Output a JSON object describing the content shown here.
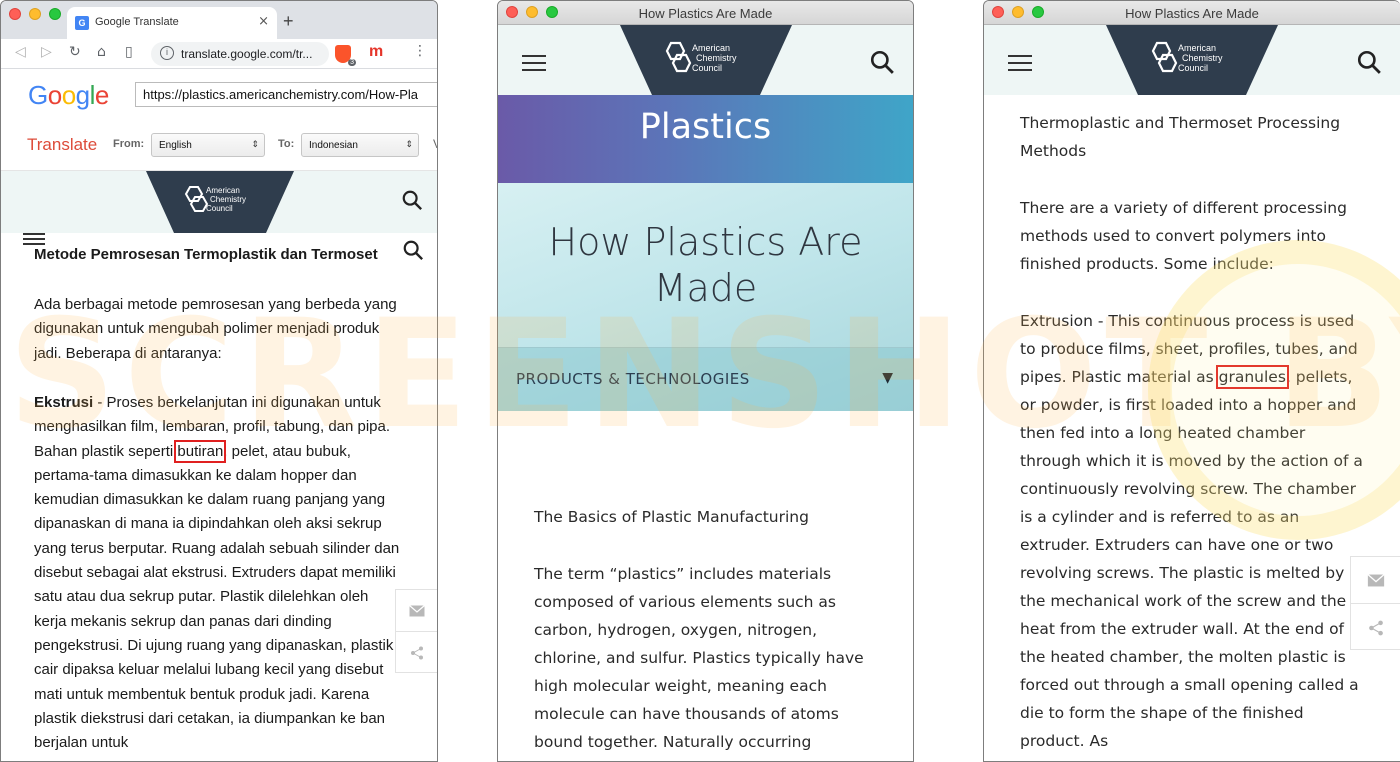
{
  "chrome": {
    "tab_title": "Google Translate",
    "tab_close": "×",
    "new_tab": "+",
    "url": "translate.google.com/tr...",
    "brave_badge": "3",
    "ext_label": "m",
    "menu": "⋮",
    "favicon_text": "G"
  },
  "translate": {
    "logo_letters": [
      {
        "ch": "G",
        "color": "#4285f4"
      },
      {
        "ch": "o",
        "color": "#ea4335"
      },
      {
        "ch": "o",
        "color": "#fbbc05"
      },
      {
        "ch": "g",
        "color": "#4285f4"
      },
      {
        "ch": "l",
        "color": "#34a853"
      },
      {
        "ch": "e",
        "color": "#ea4335"
      }
    ],
    "source_url": "https://plastics.americanchemistry.com/How-Pla",
    "title": "Translate",
    "from_label": "From:",
    "from_value": "English",
    "to_label": "To:",
    "to_value": "Indonesian",
    "more": "V"
  },
  "acc": {
    "logo_line1": "American",
    "logo_line2": "Chemistry",
    "logo_line3": "Council",
    "header_bg": "#eef6f5",
    "trap_color": "#2f3d4d"
  },
  "window1": {
    "heading": "Metode Pemrosesan Termoplastik dan Termoset",
    "para1": "Ada berbagai metode pemrosesan yang berbeda yang digunakan untuk mengubah polimer menjadi produk jadi. Beberapa di antaranya:",
    "bold_term": "Ekstrusi",
    "para2_a": " - Proses berkelanjutan ini digunakan untuk menghasilkan film, lembaran, profil, tabung, dan pipa. Bahan plastik seperti ",
    "highlight": "butiran",
    "para2_b": ", pelet, atau bubuk, pertama-tama dimasukkan ke dalam hopper dan kemudian dimasukkan ke dalam ruang panjang yang dipanaskan di mana ia dipindahkan oleh aksi sekrup yang terus berputar. Ruang adalah sebuah silinder dan disebut sebagai alat ekstrusi. Extruders dapat memiliki satu atau dua sekrup putar. Plastik dilelehkan oleh kerja mekanis sekrup dan panas dari dinding pengekstrusi. Di ujung ruang yang dipanaskan, plastik cair dipaksa keluar melalui lubang kecil yang disebut mati untuk membentuk bentuk produk jadi. Karena plastik diekstrusi dari cetakan, ia diumpankan ke ban berjalan untuk"
  },
  "window2": {
    "title": "How Plastics Are Made",
    "banner": "Plastics",
    "hero_title": "How Plastics Are Made",
    "products_label": "PRODUCTS & TECHNOLOGIES",
    "products_arrow": "▼",
    "subheading": "The Basics of Plastic Manufacturing",
    "para": "The term “plastics” includes materials composed of various elements such as carbon, hydrogen, oxygen, nitrogen, chlorine, and sulfur. Plastics typically have high molecular weight, meaning each molecule can have thousands of atoms bound together. Naturally occurring"
  },
  "window3": {
    "title": "How Plastics Are Made",
    "heading": "Thermoplastic and Thermoset Processing Methods",
    "para1": "There are a variety of different processing methods used to convert polymers into finished products. Some include:",
    "para2_a": "Extrusion - This continuous process is used to produce films, sheet, profiles, tubes, and pipes. Plastic material as ",
    "highlight": "granules",
    "para2_b": ", pellets, or powder, is first loaded into a hopper and then fed into a long heated chamber through which it is moved by the action of a continuously revolving screw. The chamber is a cylinder and is referred to as an extruder. Extruders can have one or two revolving screws. The plastic is melted by the mechanical work of the screw and the heat from the extruder wall. At the end of the heated chamber, the molten plastic is forced out through a small opening called a die to form the shape of the finished product. As"
  },
  "watermark": "SCREENSHOT BY"
}
